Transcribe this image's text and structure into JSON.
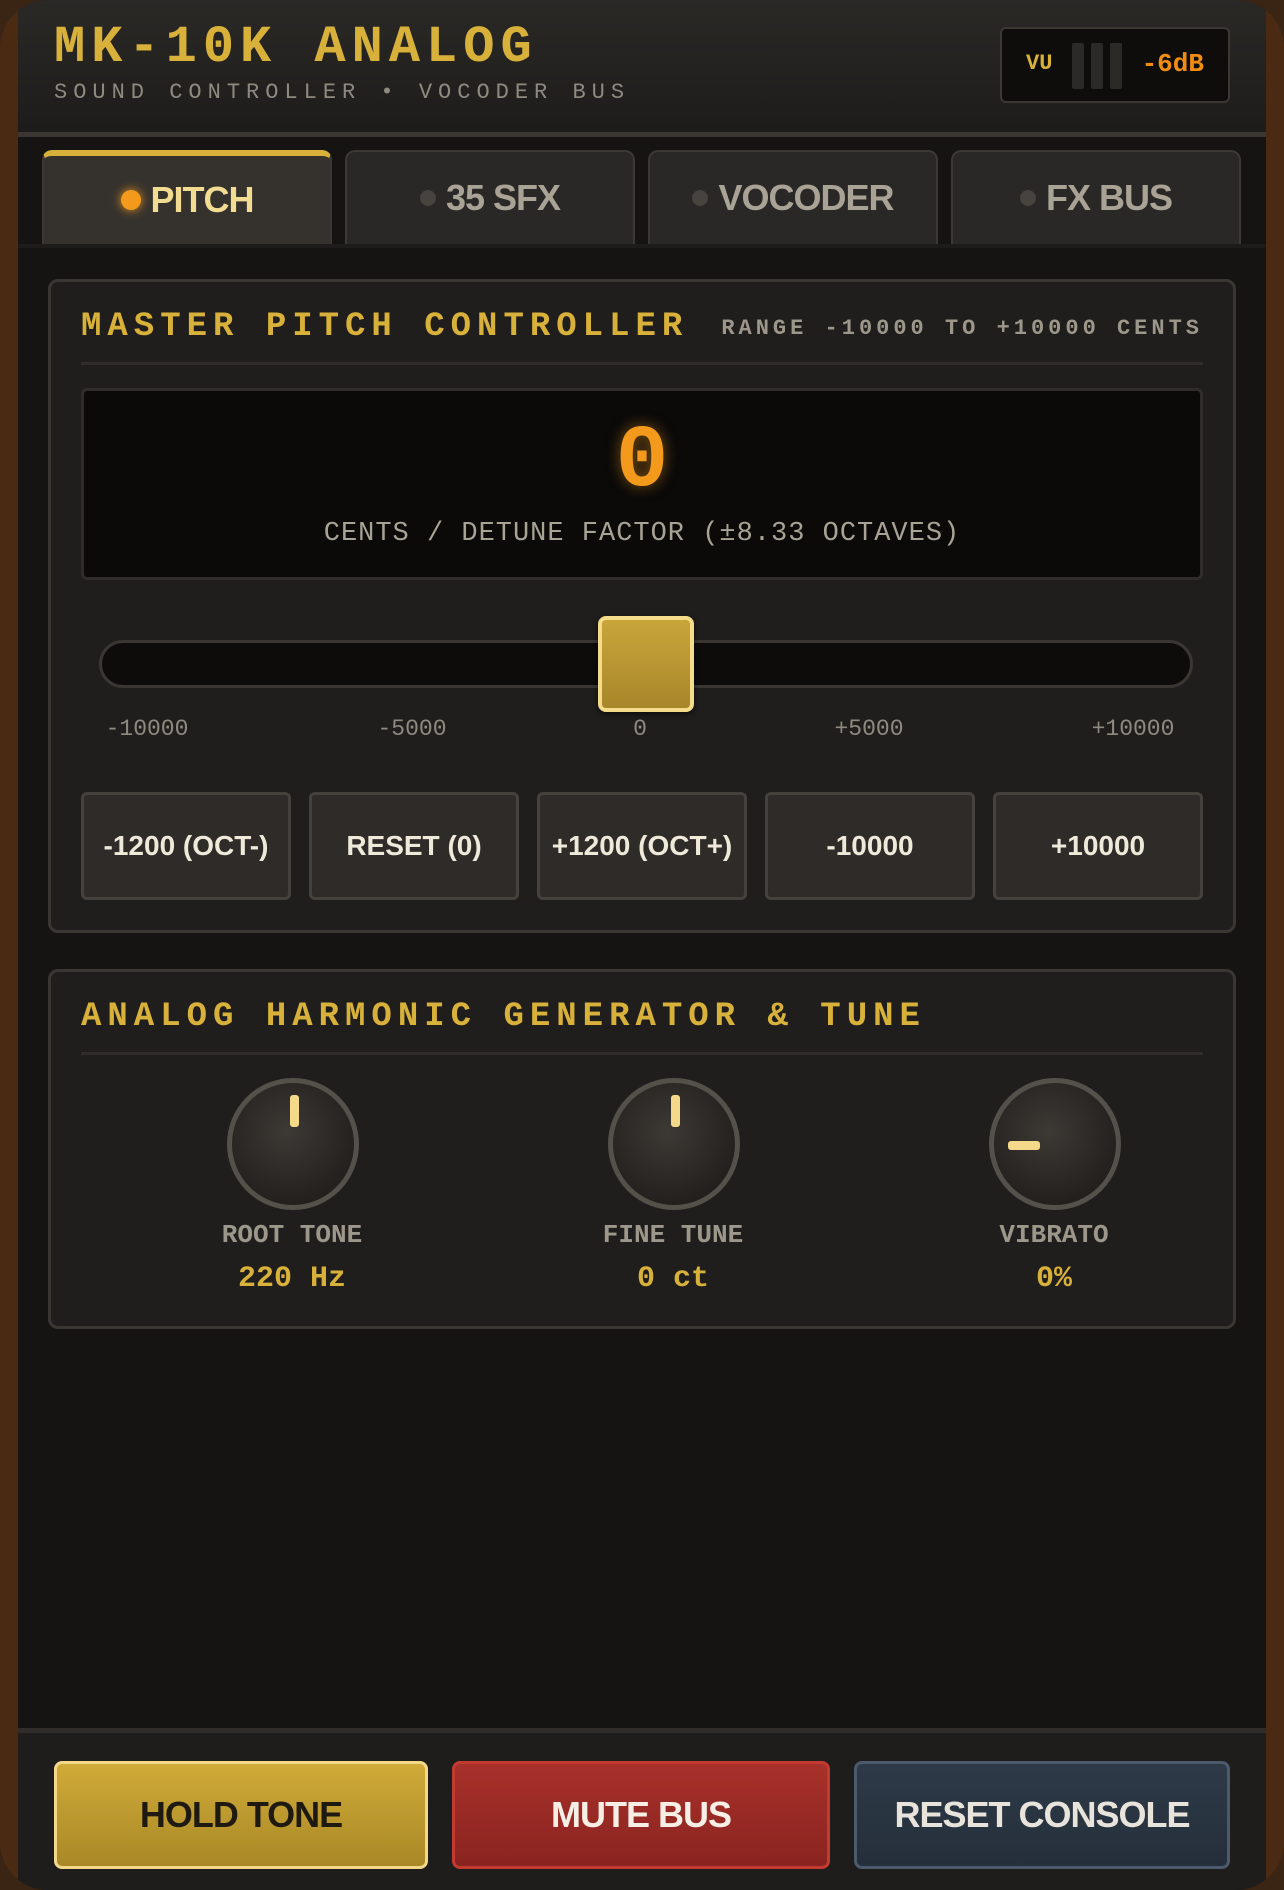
{
  "header": {
    "title": "MK-10K ANALOG",
    "subtitle": "SOUND CONTROLLER • VOCODER BUS",
    "vu_label": "VU",
    "vu_level": "-6dB"
  },
  "tabs": [
    {
      "label": "PITCH",
      "active": true
    },
    {
      "label": "35 SFX",
      "active": false
    },
    {
      "label": "VOCODER",
      "active": false
    },
    {
      "label": "FX BUS",
      "active": false
    }
  ],
  "pitch": {
    "title": "MASTER PITCH CONTROLLER",
    "range": "RANGE -10000 TO +10000 CENTS",
    "value": "0",
    "unit_label": "CENTS / DETUNE FACTOR (±8.33 OCTAVES)",
    "slider_value": 0,
    "slider_min": -10000,
    "slider_max": 10000,
    "ticks": [
      "-10000",
      "-5000",
      "0",
      "+5000",
      "+10000"
    ],
    "buttons": [
      "-1200 (OCT-)",
      "RESET (0)",
      "+1200 (OCT+)",
      "-10000",
      "+10000"
    ]
  },
  "harmonic": {
    "title": "ANALOG HARMONIC GENERATOR & TUNE",
    "knobs": [
      {
        "label": "ROOT TONE",
        "value": "220 Hz"
      },
      {
        "label": "FINE TUNE",
        "value": "0 ct"
      },
      {
        "label": "VIBRATO",
        "value": "0%"
      }
    ]
  },
  "footer": {
    "hold": "HOLD TONE",
    "mute": "MUTE BUS",
    "reset": "RESET CONSOLE"
  },
  "colors": {
    "accent": "#d8b13a",
    "display": "#f39a1c",
    "mute": "#a8302a",
    "reset": "#2e3a48"
  }
}
